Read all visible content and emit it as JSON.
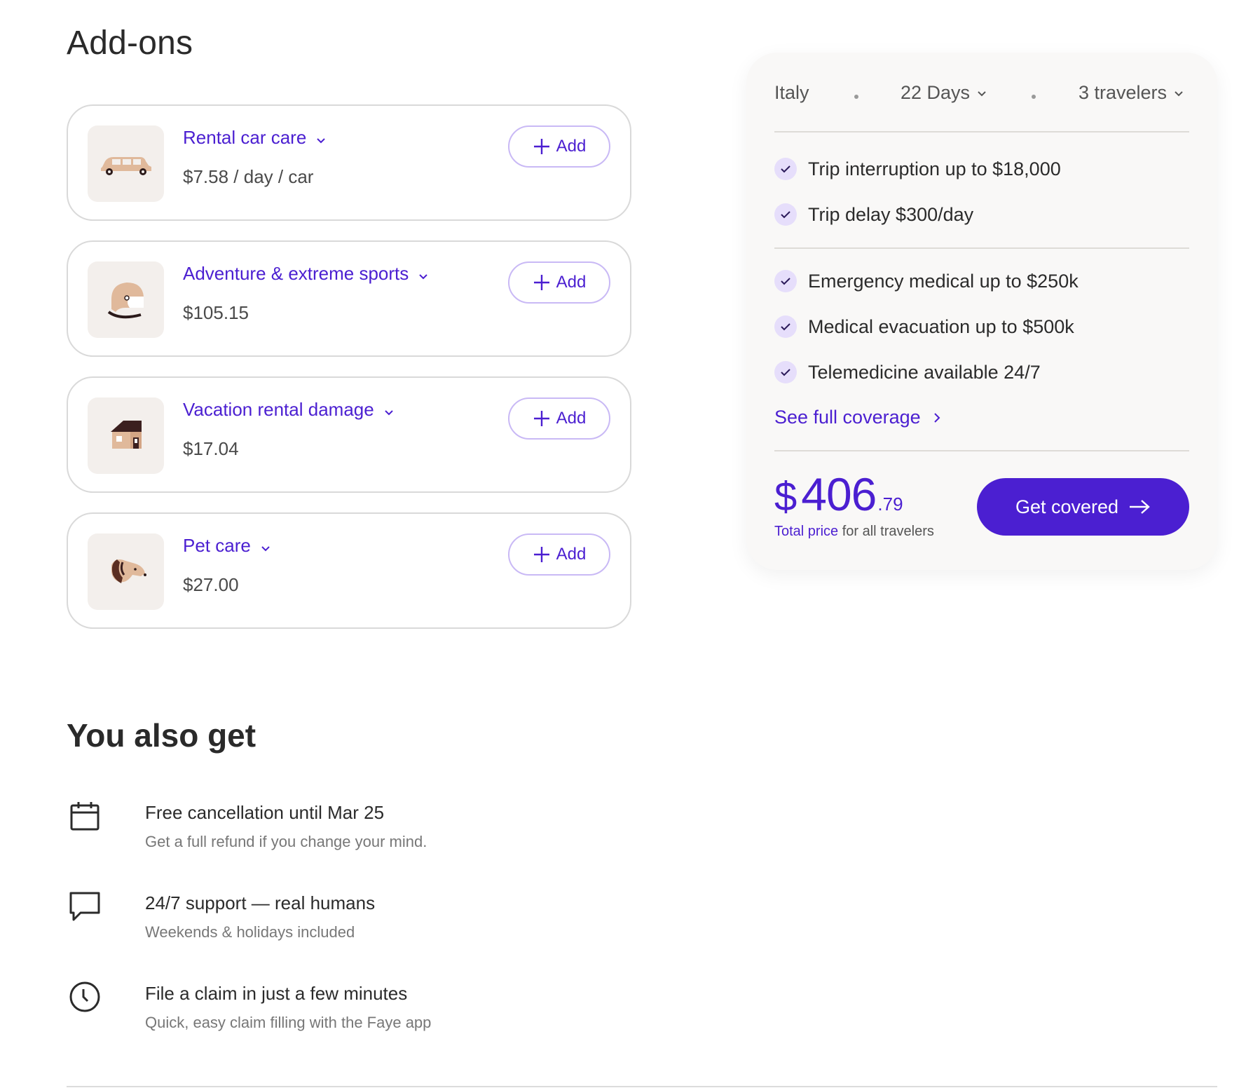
{
  "addons": {
    "heading": "Add-ons",
    "add_label": "Add",
    "items": [
      {
        "title": "Rental car care",
        "price": "$7.58 / day / car",
        "icon": "car-icon"
      },
      {
        "title": "Adventure & extreme sports",
        "price": "$105.15",
        "icon": "helmet-icon"
      },
      {
        "title": "Vacation rental damage",
        "price": "$17.04",
        "icon": "house-icon"
      },
      {
        "title": "Pet care",
        "price": "$27.00",
        "icon": "dog-icon"
      }
    ]
  },
  "summary": {
    "destination": "Italy",
    "duration": "22 Days",
    "travelers": "3 travelers",
    "features_group1": [
      "Trip interruption up to $18,000",
      "Trip delay $300/day"
    ],
    "features_group2": [
      "Emergency medical up to $250k",
      "Medical evacuation up to $500k",
      "Telemedicine available 24/7"
    ],
    "see_full": "See full coverage",
    "price_currency": "$",
    "price_int": "406",
    "price_cents": ".79",
    "price_label": "Total price",
    "price_suffix": "for all travelers",
    "cta": "Get covered"
  },
  "perks": {
    "heading": "You also get",
    "items": [
      {
        "title": "Free cancellation until Mar 25",
        "sub": "Get a full refund if you change your mind.",
        "icon": "calendar-icon"
      },
      {
        "title": "24/7 support — real humans",
        "sub": "Weekends & holidays included",
        "icon": "chat-bubble-icon"
      },
      {
        "title": "File a claim in just a few minutes",
        "sub": "Quick, easy claim filling with the Faye app",
        "icon": "clock-icon"
      }
    ]
  },
  "colors": {
    "accent": "#4b1fd1",
    "accent_light": "#e6defb",
    "thumb_bg": "#f3efec",
    "card_bg": "#f9f8f7"
  }
}
